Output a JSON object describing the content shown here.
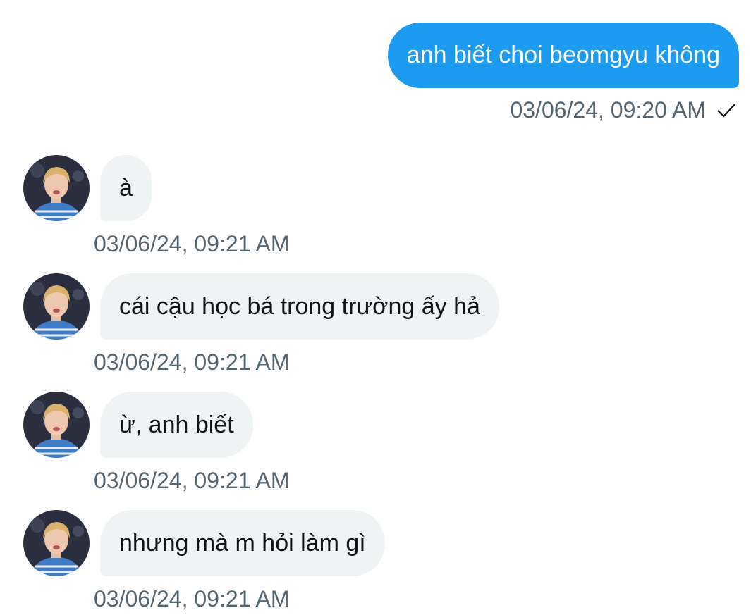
{
  "sent_message": {
    "text": "anh biết choi beomgyu không",
    "timestamp": "03/06/24, 09:20 AM",
    "status_icon": "checkmark-icon"
  },
  "received_messages": [
    {
      "text": "à",
      "timestamp": "03/06/24, 09:21 AM"
    },
    {
      "text": "cái cậu học bá trong trường ấy hả",
      "timestamp": "03/06/24, 09:21 AM"
    },
    {
      "text": "ừ, anh biết",
      "timestamp": "03/06/24, 09:21 AM"
    },
    {
      "text": "nhưng mà m hỏi làm gì",
      "timestamp": "03/06/24, 09:21 AM"
    }
  ],
  "colors": {
    "sent_bubble": "#1d9bf0",
    "received_bubble": "#eff3f4",
    "timestamp_text": "#536471"
  }
}
